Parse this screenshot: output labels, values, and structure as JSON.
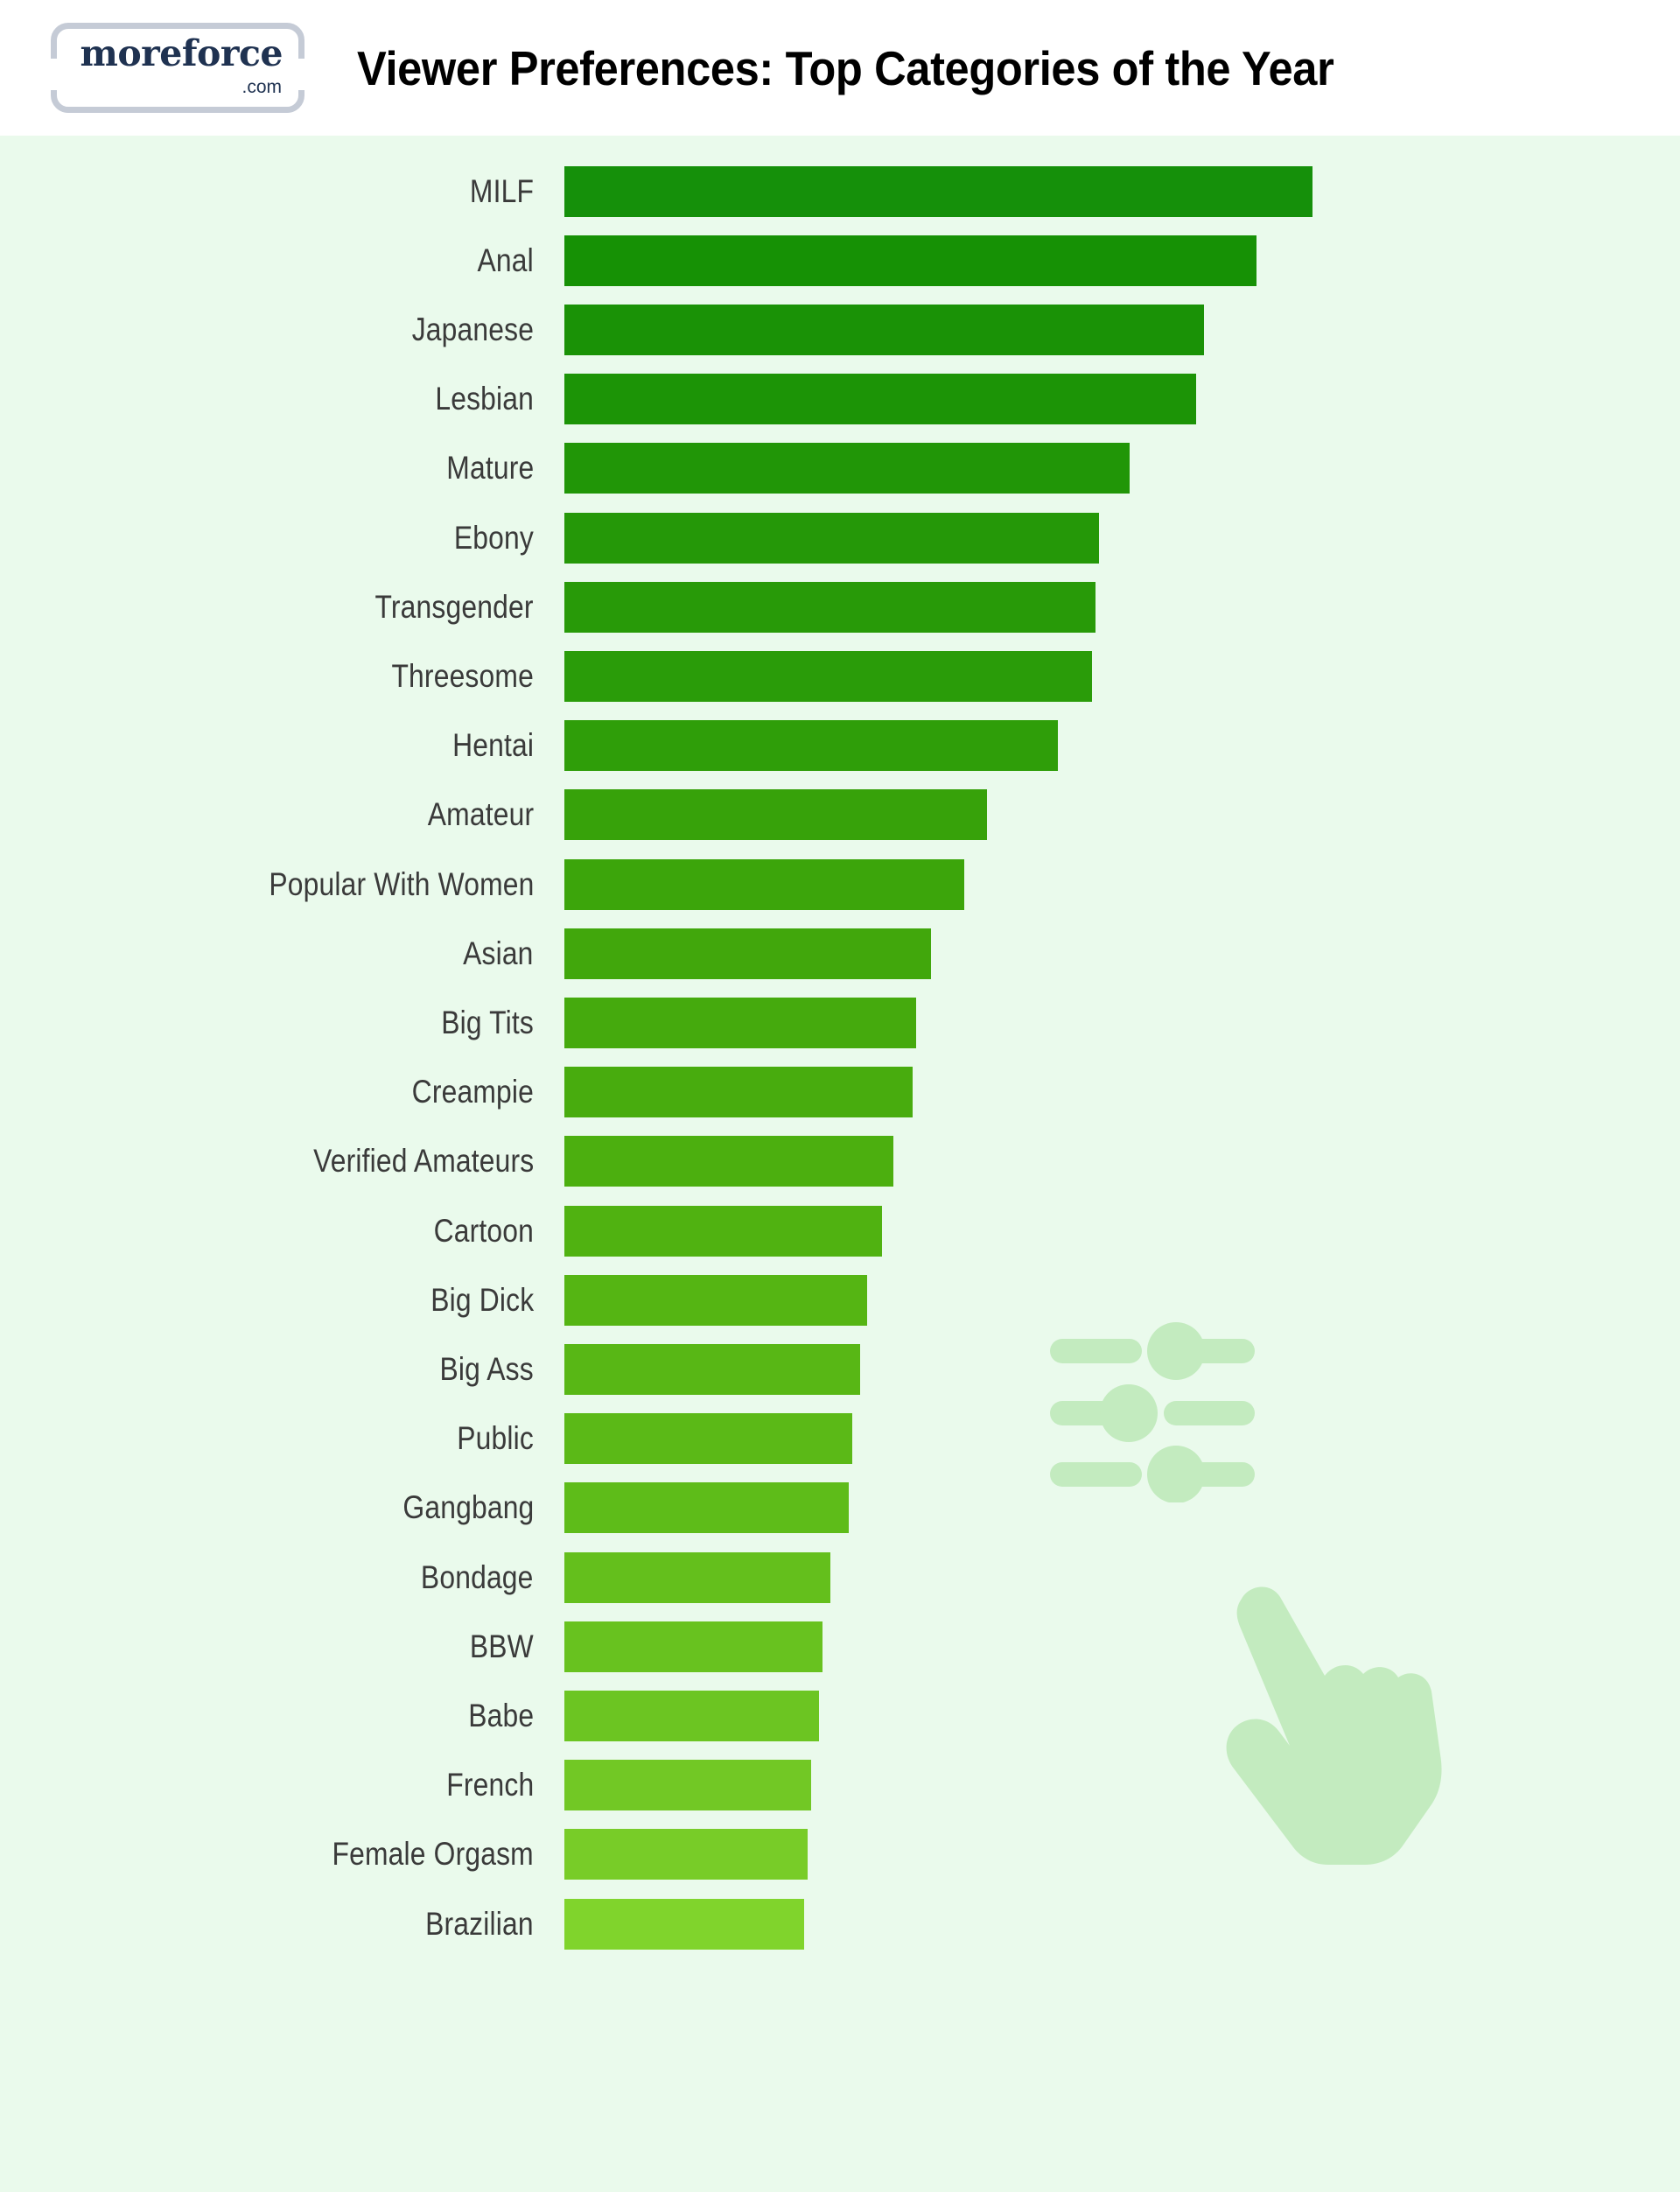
{
  "header": {
    "logo": {
      "word": "moreforce",
      "tld": ".com",
      "icon": "moreforce-logo",
      "brand_color": "#1f3251",
      "border_color": "#c5cbd6"
    },
    "title": "Viewer Preferences: Top Categories of the Year"
  },
  "theme": {
    "header_background": "#ffffff",
    "chart_background": "#eafaec",
    "label_color": "#3a3a3a",
    "bar_color_top": "#15900a",
    "bar_color_bottom": "#80d42c",
    "decoration_color": "#c3ebbf"
  },
  "decorations": [
    {
      "name": "sliders-icon",
      "label": "settings-sliders"
    },
    {
      "name": "hand-pointer-icon",
      "label": "pointing-hand-cursor"
    }
  ],
  "chart_data": {
    "type": "bar",
    "orientation": "horizontal",
    "title": "Viewer Preferences: Top Categories of the Year",
    "xlabel": "",
    "ylabel": "",
    "grid": false,
    "legend": false,
    "axis_visible": false,
    "value_labels_shown": false,
    "xlim": [
      0,
      100
    ],
    "categories": [
      "MILF",
      "Anal",
      "Japanese",
      "Lesbian",
      "Mature",
      "Ebony",
      "Transgender",
      "Threesome",
      "Hentai",
      "Amateur",
      "Popular With Women",
      "Asian",
      "Big Tits",
      "Creampie",
      "Verified Amateurs",
      "Cartoon",
      "Big Dick",
      "Big Ass",
      "Public",
      "Gangbang",
      "Bondage",
      "BBW",
      "Babe",
      "French",
      "Female Orgasm",
      "Brazilian"
    ],
    "values": [
      100,
      92.5,
      85.5,
      84.5,
      75.5,
      71.5,
      71.0,
      70.5,
      66.0,
      56.5,
      53.5,
      49.0,
      47.0,
      46.5,
      44.0,
      42.5,
      40.5,
      39.5,
      38.5,
      38.0,
      35.5,
      34.5,
      34.0,
      33.0,
      32.5,
      32.0
    ],
    "bar_colors": [
      "#15900a",
      "#169105",
      "#1a9206",
      "#1c9406",
      "#219607",
      "#259808",
      "#289a08",
      "#2a9c09",
      "#2f9e09",
      "#37a20a",
      "#3ca50b",
      "#41a70c",
      "#45aa0d",
      "#48ac0e",
      "#4caf0f",
      "#50b211",
      "#55b513",
      "#58b715",
      "#5bb917",
      "#5ebc19",
      "#64bf1c",
      "#68c21f",
      "#6cc522",
      "#72c825",
      "#78cc28",
      "#80d42c"
    ]
  }
}
